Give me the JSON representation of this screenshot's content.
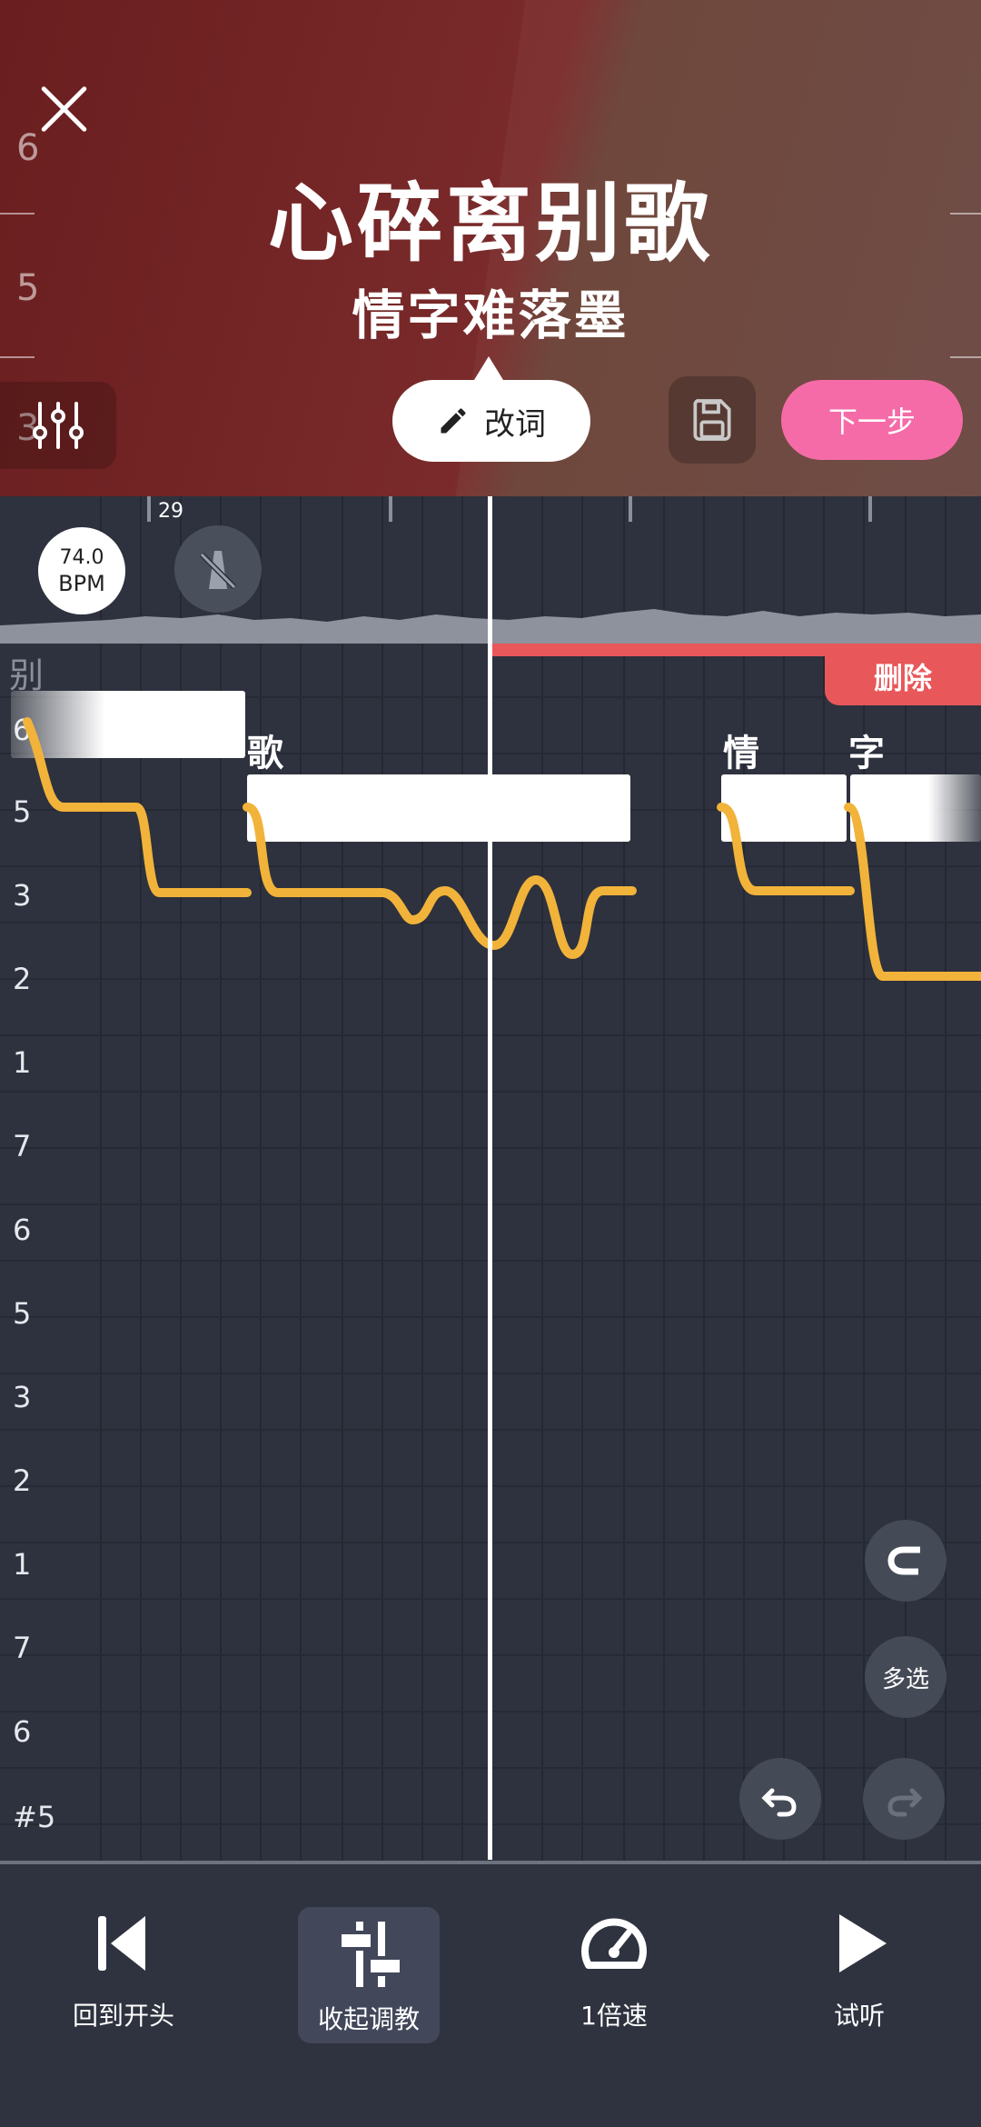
{
  "header": {
    "song_title": "心碎离别歌",
    "song_subtitle": "情字难落墨",
    "edit_lyrics_label": "改词",
    "next_step_label": "下一步",
    "scale_labels": [
      "6",
      "5",
      "3"
    ]
  },
  "editor": {
    "measure_number": "29",
    "bpm_value": "74.0",
    "bpm_unit": "BPM",
    "delete_label": "删除",
    "pitch_labels": [
      "6",
      "5",
      "3",
      "2",
      "1",
      "7",
      "6",
      "5",
      "3",
      "2",
      "1",
      "7",
      "6",
      "#5"
    ],
    "lyrics": {
      "prev": "别",
      "ge": "歌",
      "qing": "情",
      "zi": "字"
    },
    "multi_select_label": "多选"
  },
  "toolbar": {
    "items": [
      {
        "label": "回到开头",
        "icon": "skip-to-start-icon"
      },
      {
        "label": "收起调教",
        "icon": "tuning-sliders-icon"
      },
      {
        "label": "1倍速",
        "icon": "speedometer-icon"
      },
      {
        "label": "试听",
        "icon": "play-icon"
      }
    ]
  },
  "colors": {
    "accent_pink": "#f56ba8",
    "delete_red": "#e8575a",
    "pitch_curve": "#f2b33a",
    "header_bg": "#6a1e1f"
  }
}
